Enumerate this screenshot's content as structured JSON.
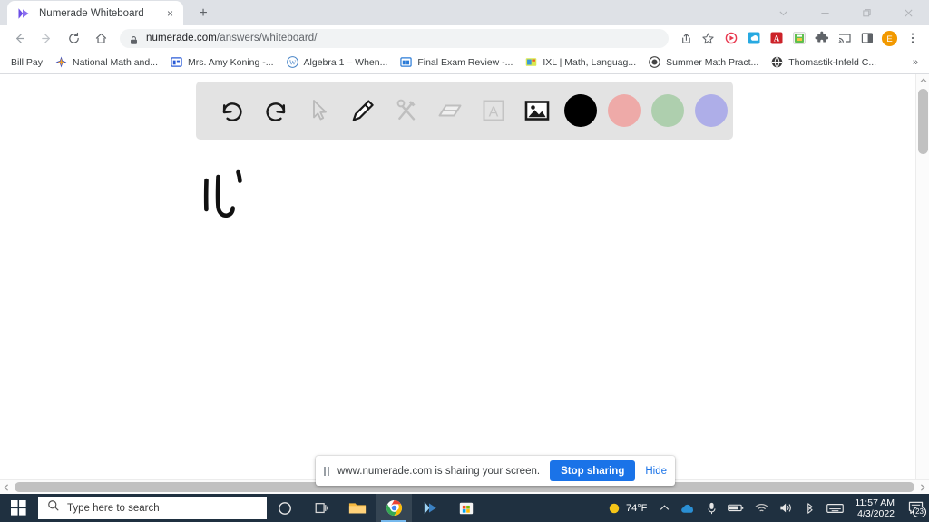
{
  "browser": {
    "tab": {
      "title": "Numerade Whiteboard",
      "favicon": "numerade-logo-icon",
      "close_label": "×"
    },
    "new_tab_label": "+",
    "window_controls": [
      {
        "name": "tab-search",
        "label": "ˇ"
      },
      {
        "name": "minimize",
        "label": "—"
      },
      {
        "name": "maximize",
        "label": "❐"
      },
      {
        "name": "close",
        "label": "✕"
      }
    ],
    "nav": {
      "back_label": "←",
      "forward_label": "→",
      "reload_label": "⟳",
      "home_label": "⌂"
    },
    "omnibox": {
      "lock_icon": "lock-icon",
      "url_domain": "numerade.com",
      "url_path": "/answers/whiteboard/"
    },
    "omnibox_actions": [
      {
        "name": "share-icon",
        "label": "⤴"
      },
      {
        "name": "bookmark-star-icon",
        "label": "☆"
      }
    ],
    "extensions": [
      {
        "name": "numerade-extension-icon",
        "color": "#e8384f"
      },
      {
        "name": "cloud-extension-icon",
        "color": "#27a9e1"
      },
      {
        "name": "adobe-acrobat-extension-icon",
        "color": "#cc2229"
      },
      {
        "name": "grammar-extension-icon",
        "color": "#5fbf4d"
      },
      {
        "name": "extensions-puzzle-icon",
        "color": "#5f6368"
      },
      {
        "name": "cast-icon",
        "color": "#5f6368"
      },
      {
        "name": "split-screen-icon",
        "color": "#5f6368"
      },
      {
        "name": "profile-avatar",
        "color": "#f29900",
        "label": "E"
      },
      {
        "name": "chrome-menu-icon",
        "label": "⋮"
      }
    ],
    "bookmarks": [
      {
        "label": "Bill Pay",
        "icon": "none",
        "color": "transparent"
      },
      {
        "label": "National Math and...",
        "icon": "star-burst-icon",
        "color": "#3b4ec0"
      },
      {
        "label": "Mrs. Amy Koning -...",
        "icon": "window-icon",
        "color": "#2a5bd7"
      },
      {
        "label": "Algebra 1 – When...",
        "icon": "wordpress-icon",
        "color": "#4a86c8"
      },
      {
        "label": "Final Exam Review -...",
        "icon": "columns-icon",
        "color": "#2a7bd7"
      },
      {
        "label": "IXL | Math, Languag...",
        "icon": "ixl-icon",
        "color": "#d8e84f"
      },
      {
        "label": "Summer Math Pract...",
        "icon": "globe-dark-icon",
        "color": "#444444"
      },
      {
        "label": "Thomastik-Infeld C...",
        "icon": "globe-icon",
        "color": "#3a3a3a"
      }
    ],
    "bookmarks_overflow_label": "»"
  },
  "whiteboard": {
    "tools": [
      {
        "name": "undo-icon",
        "label": "Undo",
        "active": false,
        "state": "enabled"
      },
      {
        "name": "redo-icon",
        "label": "Redo",
        "active": false,
        "state": "enabled"
      },
      {
        "name": "cursor-select-icon",
        "label": "Select",
        "active": false,
        "state": "inactive"
      },
      {
        "name": "pencil-icon",
        "label": "Pen",
        "active": true,
        "state": "active"
      },
      {
        "name": "shapes-tools-icon",
        "label": "Shapes",
        "active": false,
        "state": "inactive"
      },
      {
        "name": "eraser-icon",
        "label": "Eraser",
        "active": false,
        "state": "inactive"
      },
      {
        "name": "text-tool-icon",
        "label": "Text",
        "active": false,
        "state": "inactive"
      },
      {
        "name": "image-tool-icon",
        "label": "Image",
        "active": true,
        "state": "active"
      }
    ],
    "colors": [
      {
        "name": "color-swatch-black",
        "hex": "#000000",
        "selected": true
      },
      {
        "name": "color-swatch-pink",
        "hex": "#eeaaa8",
        "selected": false
      },
      {
        "name": "color-swatch-green",
        "hex": "#aecfae",
        "selected": false
      },
      {
        "name": "color-swatch-purple",
        "hex": "#aeaee8",
        "selected": false
      }
    ],
    "toolbar_bg": "#e3e3e3",
    "canvas_bg": "#ffffff",
    "ink_color": "#111111"
  },
  "share_bar": {
    "pause_icon": "pause-icon",
    "message": "www.numerade.com is sharing your screen.",
    "stop_label": "Stop sharing",
    "hide_label": "Hide",
    "accent": "#1a73e8"
  },
  "taskbar": {
    "start_label": "Start",
    "search_icon": "search-icon",
    "search_placeholder": "Type here to search",
    "apps": [
      {
        "name": "cortana-icon",
        "label": "Cortana",
        "active": false
      },
      {
        "name": "task-view-icon",
        "label": "Task View",
        "active": false
      },
      {
        "name": "file-explorer-icon",
        "label": "File Explorer",
        "active": false
      },
      {
        "name": "chrome-icon",
        "label": "Google Chrome",
        "active": true
      },
      {
        "name": "numerade-app-icon",
        "label": "Numerade",
        "active": false
      },
      {
        "name": "microsoft-store-icon",
        "label": "Microsoft Store",
        "active": false
      }
    ],
    "weather": {
      "icon": "sun-icon",
      "temperature": "74°F"
    },
    "tray": [
      {
        "name": "show-hidden-icons-chevron",
        "label": "⌃"
      },
      {
        "name": "onedrive-icon",
        "label": "☁"
      },
      {
        "name": "microphone-icon",
        "label": "ᴜ"
      },
      {
        "name": "battery-icon",
        "label": "▬"
      },
      {
        "name": "wifi-icon",
        "label": "◠"
      },
      {
        "name": "volume-icon",
        "label": "ᵅ"
      },
      {
        "name": "bluetooth-pen-icon",
        "label": "✐"
      },
      {
        "name": "keyboard-icon",
        "label": "⌨"
      }
    ],
    "clock": {
      "time": "11:57 AM",
      "date": "4/3/2022"
    },
    "notifications": {
      "name": "action-center-icon",
      "count": "23"
    }
  }
}
